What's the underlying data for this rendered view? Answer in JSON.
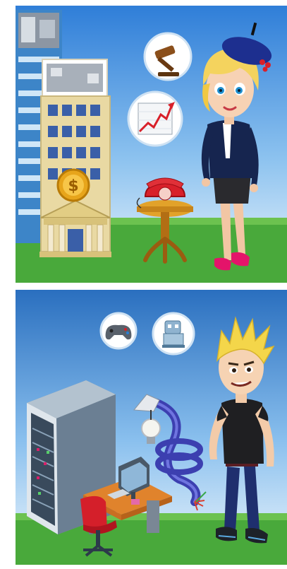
{
  "panels": [
    {
      "id": "business",
      "icons": [
        "gavel-icon",
        "stock-chart-icon",
        "dollar-coin-icon",
        "rotary-phone-icon"
      ],
      "character": "businesswoman-in-beret"
    },
    {
      "id": "technology",
      "icons": [
        "game-controller-icon",
        "robot-icon",
        "light-bulb-icon",
        "network-cable-icon"
      ],
      "character": "blond-spiky-haired-man"
    }
  ],
  "colors": {
    "sky_top": "#2f7ed8",
    "sky_bottom": "#eaf4fb",
    "grass": "#49a93b",
    "building": "#e9d9a3",
    "server": "#8ea2b4",
    "accent_red": "#d8202a",
    "navy": "#1f2a5a"
  }
}
